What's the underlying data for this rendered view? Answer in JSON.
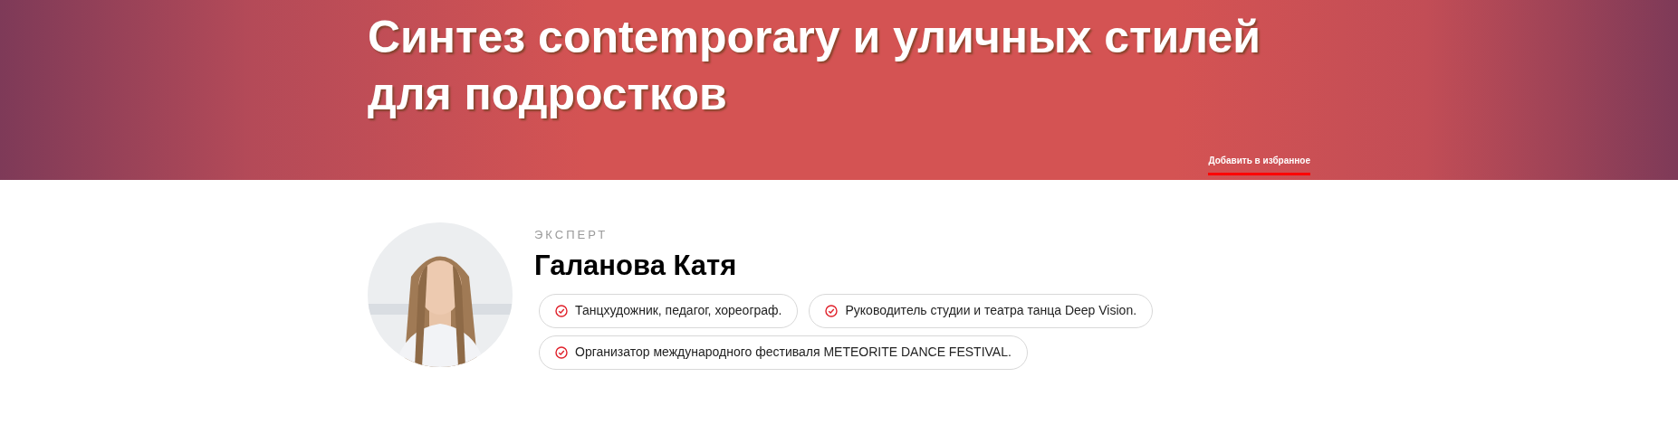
{
  "hero": {
    "title": "Синтез contemporary и уличных стилей для подростков",
    "favorite_link": "Добавить в избранное"
  },
  "expert": {
    "label": "ЭКСПЕРТ",
    "name": "Галанова Катя",
    "facts": [
      "Танцхудожник, педагог, хореограф.",
      "Руководитель студии и театра танца Deep Vision.",
      "Организатор международного фестиваля METEORITE DANCE FESTIVAL."
    ]
  }
}
